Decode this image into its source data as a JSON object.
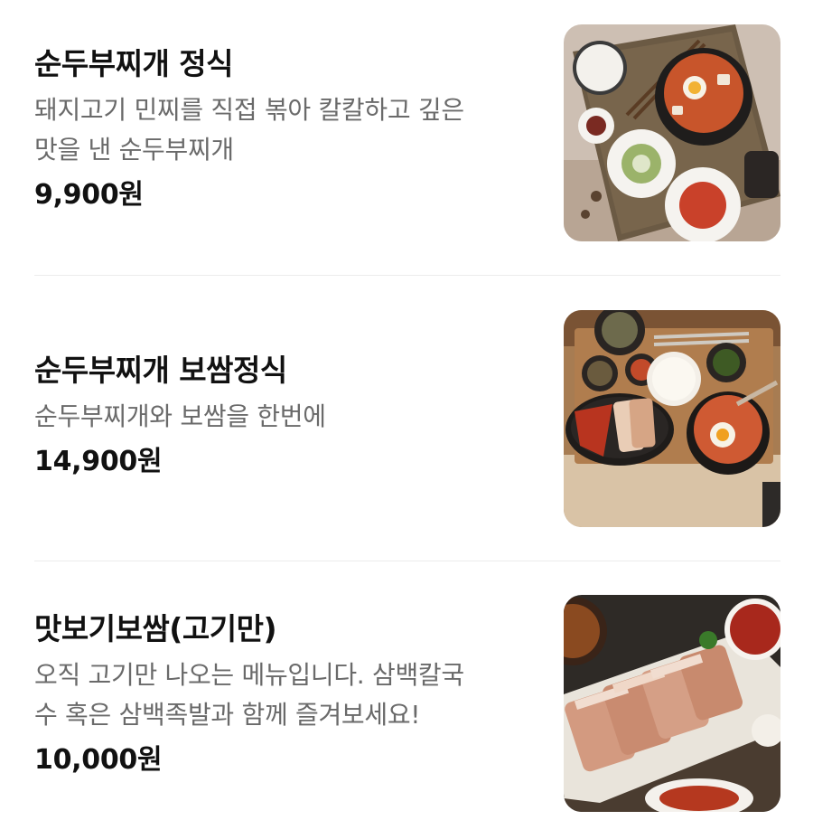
{
  "menu": {
    "items": [
      {
        "name": "순두부찌개 정식",
        "description_lines": [
          "돼지고기 민찌를 직접 볶아 칼칼하고 깊은",
          "맛을 낸 순두부찌개"
        ],
        "price": "9,900원",
        "image_icon": "sundubu-set-photo"
      },
      {
        "name": "순두부찌개 보쌈정식",
        "description_lines": [
          "순두부찌개와 보쌈을 한번에"
        ],
        "price": "14,900원",
        "image_icon": "bossam-set-photo"
      },
      {
        "name": "맛보기보쌈(고기만)",
        "description_lines": [
          "오직 고기만 나오는 메뉴입니다. 삼백칼국",
          "수 혹은 삼백족발과 함께 즐겨보세요!"
        ],
        "price": "10,000원",
        "image_icon": "pork-slices-photo"
      }
    ]
  },
  "colors": {
    "name_text": "#111111",
    "description_text": "#6a6a6a",
    "divider": "#ececec"
  }
}
